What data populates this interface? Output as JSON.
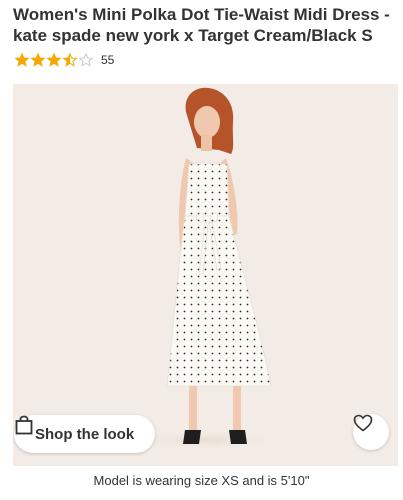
{
  "product": {
    "title": "Women's Mini Polka Dot Tie-Waist Midi Dress - kate spade new york x Target Cream/Black S",
    "rating": 3.5,
    "rating_max": 5,
    "review_count": "55",
    "star_color": "#f2a900",
    "star_empty_color": "#cccccc"
  },
  "image": {
    "background_color": "#f3ebe5",
    "shop_button_label": "Shop the look",
    "shop_button_icon": "shopping-bag-icon",
    "favorite_icon": "heart-outline-icon"
  },
  "caption": {
    "model_note": "Model is wearing size XS and is 5'10\""
  }
}
